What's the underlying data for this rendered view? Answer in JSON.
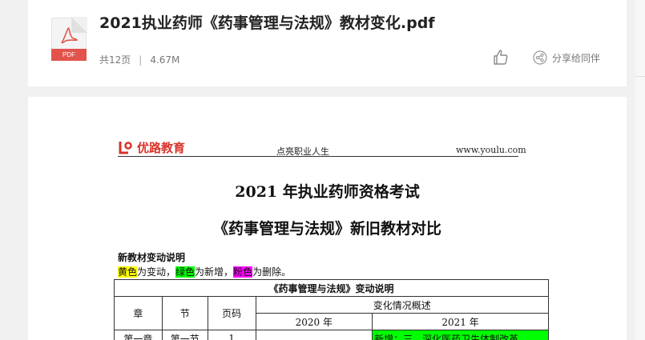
{
  "header": {
    "title": "2021执业药师《药事管理与法规》教材变化.pdf",
    "file_tag": "PDF",
    "pages": "共12页",
    "separator": "|",
    "size": "4.67M",
    "like_icon": "thumbs-up-icon",
    "share_icon": "share-icon",
    "share_label": "分享给同伴"
  },
  "document": {
    "brand": "优路教育",
    "slogan": "点亮职业人生",
    "site": "www.youlu.com",
    "title": "2021 年执业药师资格考试",
    "subtitle": "《药事管理与法规》新旧教材对比",
    "note_title": "新教材变动说明",
    "legend": {
      "yellow": "黄色",
      "yellow_text": "为变动，",
      "green": "绿色",
      "green_text": "为新增，",
      "pink": "粉色",
      "pink_text": "为删除。"
    },
    "table": {
      "caption": "《药事管理与法规》变动说明",
      "col_chapter": "章",
      "col_section": "节",
      "col_page": "页码",
      "col_overview": "变化情况概述",
      "col_2020": "2020 年",
      "col_2021": "2021 年",
      "row1_chapter": "第一章",
      "row1_section": "第一节",
      "row1_page": "1",
      "row1_2021": "新增：三、深化医药卫生体制改革"
    },
    "colors": {
      "yellow": "#ffff00",
      "green": "#00ff00",
      "pink": "#ff00ff",
      "brand": "#d9332b"
    }
  }
}
